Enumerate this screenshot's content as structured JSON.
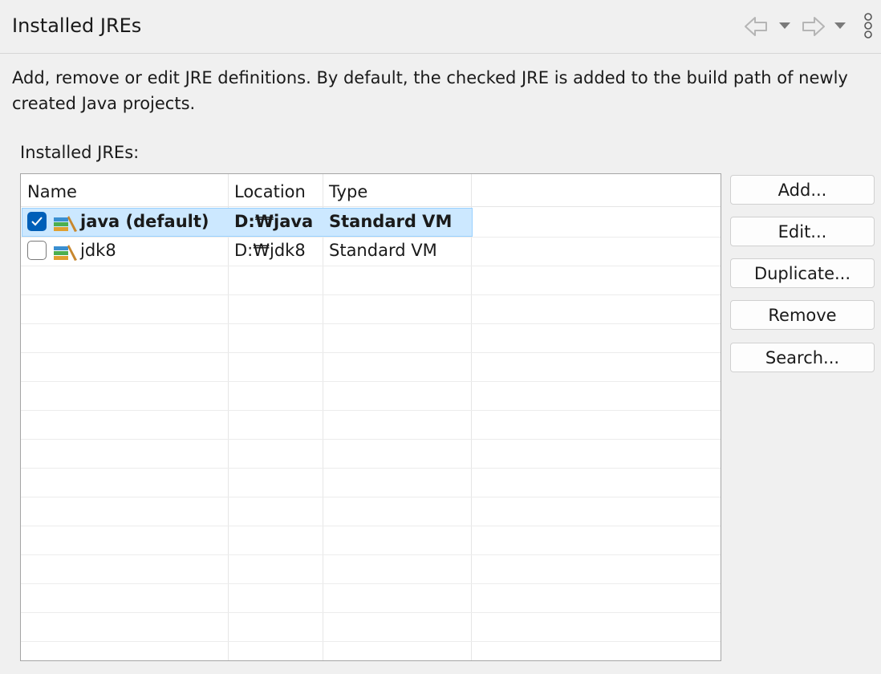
{
  "page": {
    "title": "Installed JREs",
    "description_line1": "Add, remove or edit JRE definitions. By default, the checked JRE is added to the build path of newly",
    "description_line2": "created Java projects.",
    "list_label": "Installed JREs:"
  },
  "nav": {
    "back_icon": "arrow-left-icon",
    "forward_icon": "arrow-right-icon",
    "menu_icon": "vertical-ellipsis-icon"
  },
  "table": {
    "columns": [
      "Name",
      "Location",
      "Type"
    ],
    "rows": [
      {
        "checked": true,
        "name": "java (default)",
        "location": "D:₩java",
        "type": "Standard VM",
        "selected": true
      },
      {
        "checked": false,
        "name": "jdk8",
        "location": "D:₩jdk8",
        "type": "Standard VM",
        "selected": false
      }
    ]
  },
  "buttons": {
    "add": "Add...",
    "edit": "Edit...",
    "duplicate": "Duplicate...",
    "remove": "Remove",
    "search": "Search..."
  },
  "colors": {
    "selection": "#cce8ff",
    "checkbox_checked": "#005fb8"
  }
}
